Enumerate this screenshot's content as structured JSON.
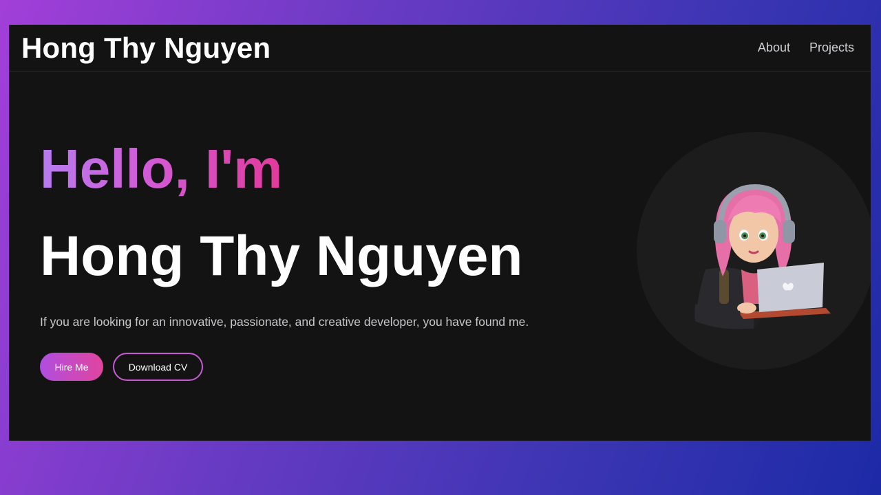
{
  "header": {
    "brand": "Hong Thy Nguyen",
    "nav": [
      {
        "label": "About"
      },
      {
        "label": "Projects"
      }
    ]
  },
  "hero": {
    "greeting": "Hello, I'm",
    "name": "Hong Thy Nguyen",
    "tagline": "If you are looking for an innovative, passionate, and creative developer, you have found me.",
    "primary_button": "Hire Me",
    "secondary_button": "Download CV"
  },
  "colors": {
    "accent_start": "#b04ee0",
    "accent_end": "#e0459e",
    "background": "#131313"
  },
  "image": {
    "icon": "developer-avatar-illustration"
  }
}
